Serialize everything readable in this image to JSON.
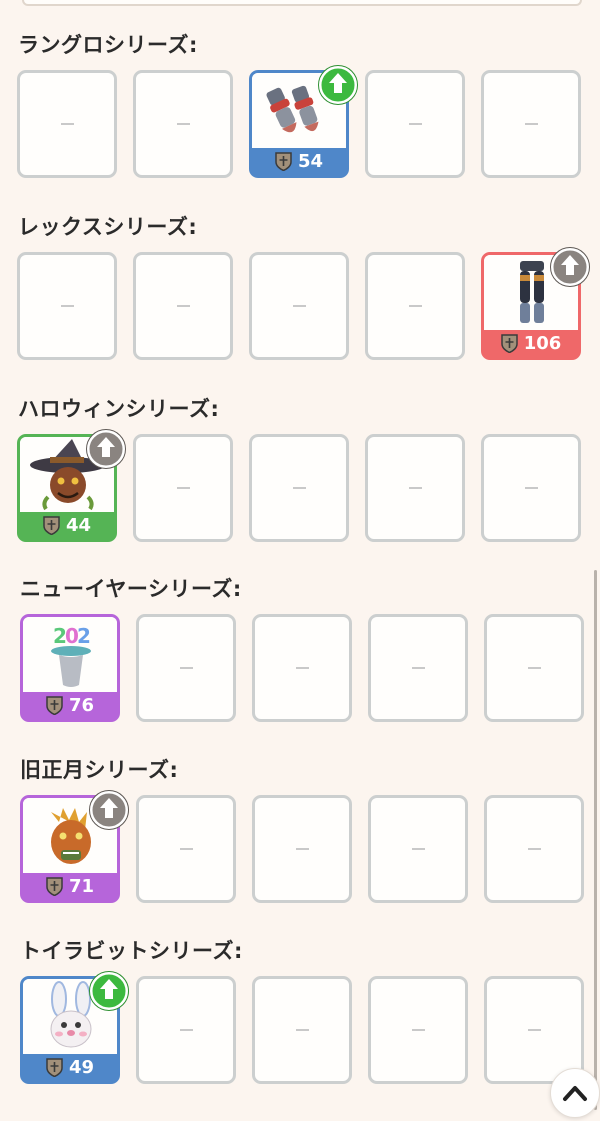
{
  "sections": [
    {
      "title": "ラングロシリーズ:",
      "item": {
        "value": "54",
        "color": "blue",
        "upgrade": "green",
        "icon": "gloves-icon"
      }
    },
    {
      "title": "レックスシリーズ:",
      "item": {
        "value": "106",
        "color": "red",
        "upgrade": "gray",
        "icon": "leg-armor-icon"
      }
    },
    {
      "title": "ハロウィンシリーズ:",
      "item": {
        "value": "44",
        "color": "green",
        "upgrade": "gray",
        "icon": "witch-hat-mask-icon"
      }
    },
    {
      "title": "ニューイヤーシリーズ:",
      "item": {
        "value": "76",
        "color": "purple",
        "upgrade": "none",
        "icon": "new-year-hat-icon"
      }
    },
    {
      "title": "旧正月シリーズ:",
      "item": {
        "value": "71",
        "color": "purple",
        "upgrade": "gray",
        "icon": "dragon-mask-icon"
      }
    },
    {
      "title": "トイラビットシリーズ:",
      "item": {
        "value": "49",
        "color": "blue",
        "upgrade": "green",
        "icon": "bunny-mask-icon"
      }
    }
  ],
  "empty_slot_symbol": "—",
  "colors": {
    "blue": "#4f87c9",
    "red": "#ef6869",
    "green": "#55b455",
    "purple": "#b665da",
    "upgrade_green": "#3cb93f",
    "upgrade_gray": "#8a8480"
  }
}
